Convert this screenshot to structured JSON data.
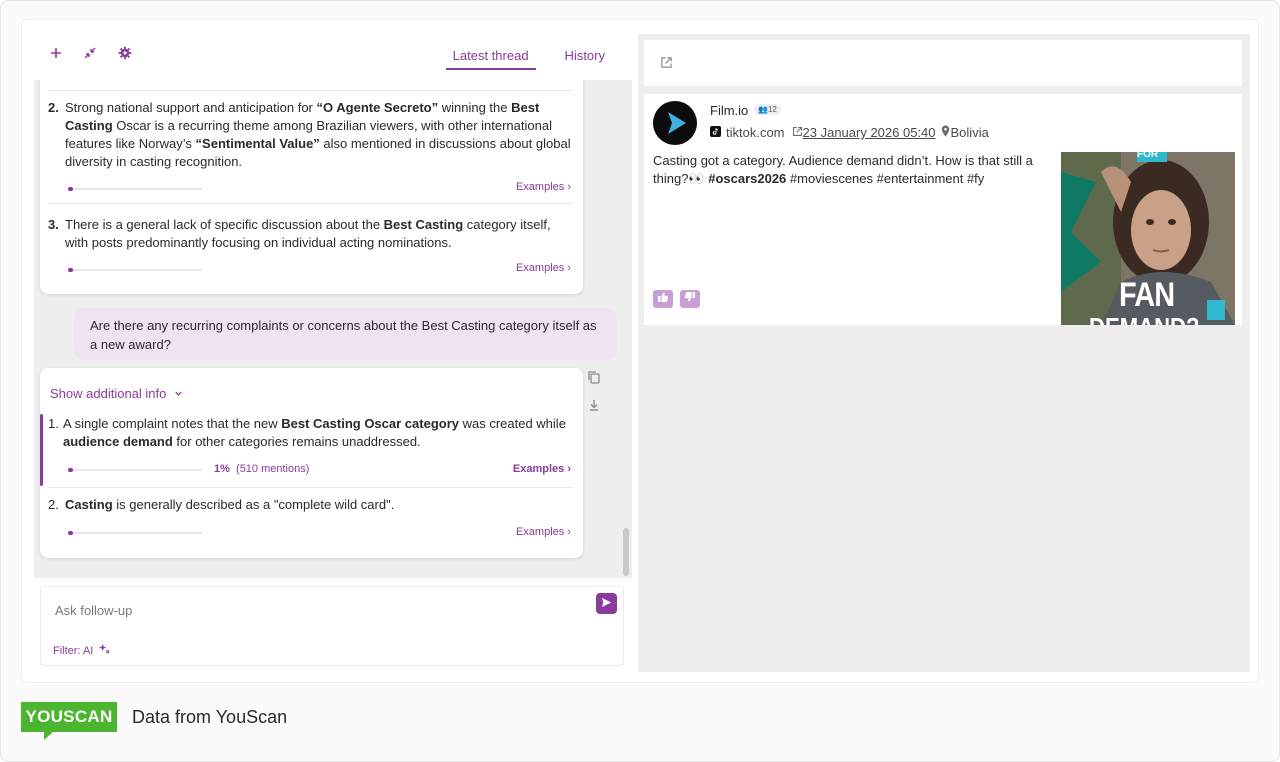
{
  "toolbar": {
    "icons": [
      "plus-icon",
      "collapse-icon",
      "gear-icon"
    ],
    "tabs": [
      {
        "label": "Latest thread",
        "active": true
      },
      {
        "label": "History",
        "active": false
      }
    ]
  },
  "thread": {
    "first_answer": {
      "items": [
        {
          "num": "2.",
          "parts": [
            "Strong national support and anticipation for ",
            "“O Agente Secreto”",
            " winning the ",
            "Best Casting",
            " Oscar is a recurring theme among Brazilian viewers, with other international features like Norway’s ",
            "“Sentimental Value”",
            " also mentioned in discussions about global diversity in casting recognition."
          ],
          "examples_label": "Examples ›"
        },
        {
          "num": "3.",
          "parts": [
            "There is a general lack of specific discussion about the ",
            "Best Casting",
            " category itself, with posts predominantly focusing on individual acting nominations."
          ],
          "examples_label": "Examples ›"
        }
      ]
    },
    "user_question": "Are there any recurring complaints or concerns about the Best Casting category itself as a new award?",
    "second_answer": {
      "show_info_label": "Show additional info",
      "items": [
        {
          "num": "1.",
          "parts": [
            "A single complaint notes that the new ",
            "Best Casting Oscar category",
            " was created while ",
            "audience demand",
            " for other categories remains unaddressed."
          ],
          "percent": "1%",
          "mentions": "(510 mentions)",
          "examples_label": "Examples ›"
        },
        {
          "num": "2.",
          "parts": [
            "Casting",
            " is generally described as a \"complete wild card\"."
          ],
          "examples_label": "Examples ›"
        }
      ]
    }
  },
  "compose": {
    "placeholder": "Ask follow-up",
    "filter_label": "Filter: AI"
  },
  "post": {
    "author": "Film.io",
    "follower_badge": "12",
    "source": "tiktok.com",
    "date": "23 January 2026 05:40",
    "location": "Bolivia",
    "text_plain": "Casting got a category. Audience demand didn’t. How is that still a thing?👀 ",
    "text_bold": "#oscars2026",
    "text_tags": " #moviescenes #entertainment #fy",
    "thumbnail_text": [
      "FOR",
      "FAN",
      "DEMAND?"
    ]
  },
  "footer": {
    "logo": "YOUSCAN",
    "caption": "Data from YouScan"
  },
  "colors": {
    "accent": "#8a3b9b",
    "bubble": "#efe3f2",
    "brand_green": "#4cb52f",
    "panel_bg": "#eeeeee"
  }
}
